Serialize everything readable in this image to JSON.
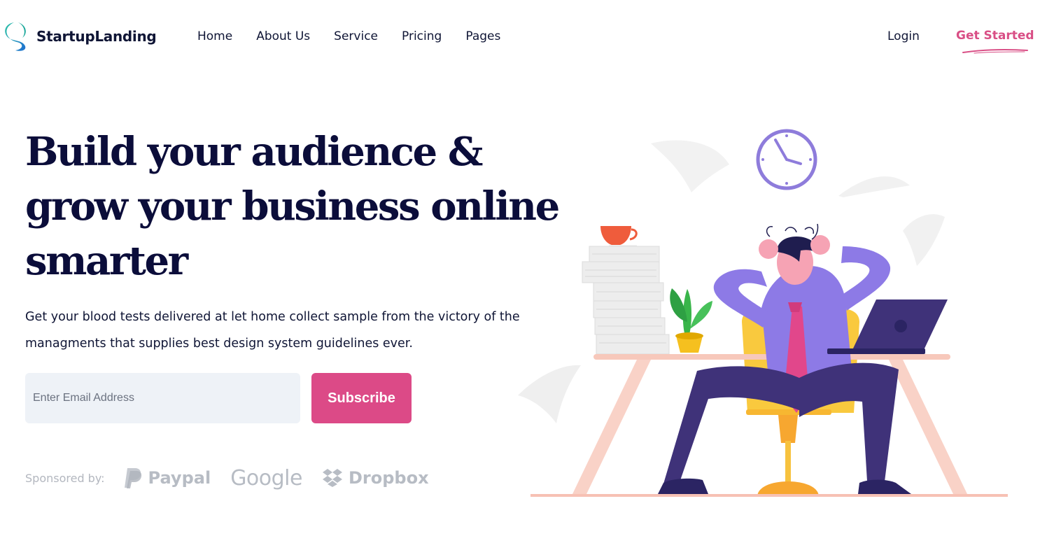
{
  "brand": {
    "name": "StartupLanding",
    "logo_icon": "leaf-logo-icon",
    "accent_color": "#d94f86"
  },
  "nav": {
    "items": [
      {
        "label": "Home"
      },
      {
        "label": "About Us"
      },
      {
        "label": "Service"
      },
      {
        "label": "Pricing"
      },
      {
        "label": "Pages"
      }
    ],
    "login_label": "Login",
    "cta_label": "Get Started"
  },
  "hero": {
    "title_lines": [
      "Build your audience &",
      "grow your business online",
      "smarter"
    ],
    "description": "Get your blood tests delivered at let home collect sample from the victory of the managments that supplies best design system guidelines ever.",
    "email_placeholder": "Enter Email Address",
    "subscribe_label": "Subscribe",
    "subscribe_color": "#dc4a87"
  },
  "sponsors": {
    "label": "Sponsored by:",
    "items": [
      {
        "name": "Paypal",
        "icon": "paypal-icon"
      },
      {
        "name": "Google",
        "icon": ""
      },
      {
        "name": "Dropbox",
        "icon": "dropbox-icon"
      }
    ]
  },
  "illustration": {
    "subject": "stressed-man-at-desk-illustration"
  }
}
